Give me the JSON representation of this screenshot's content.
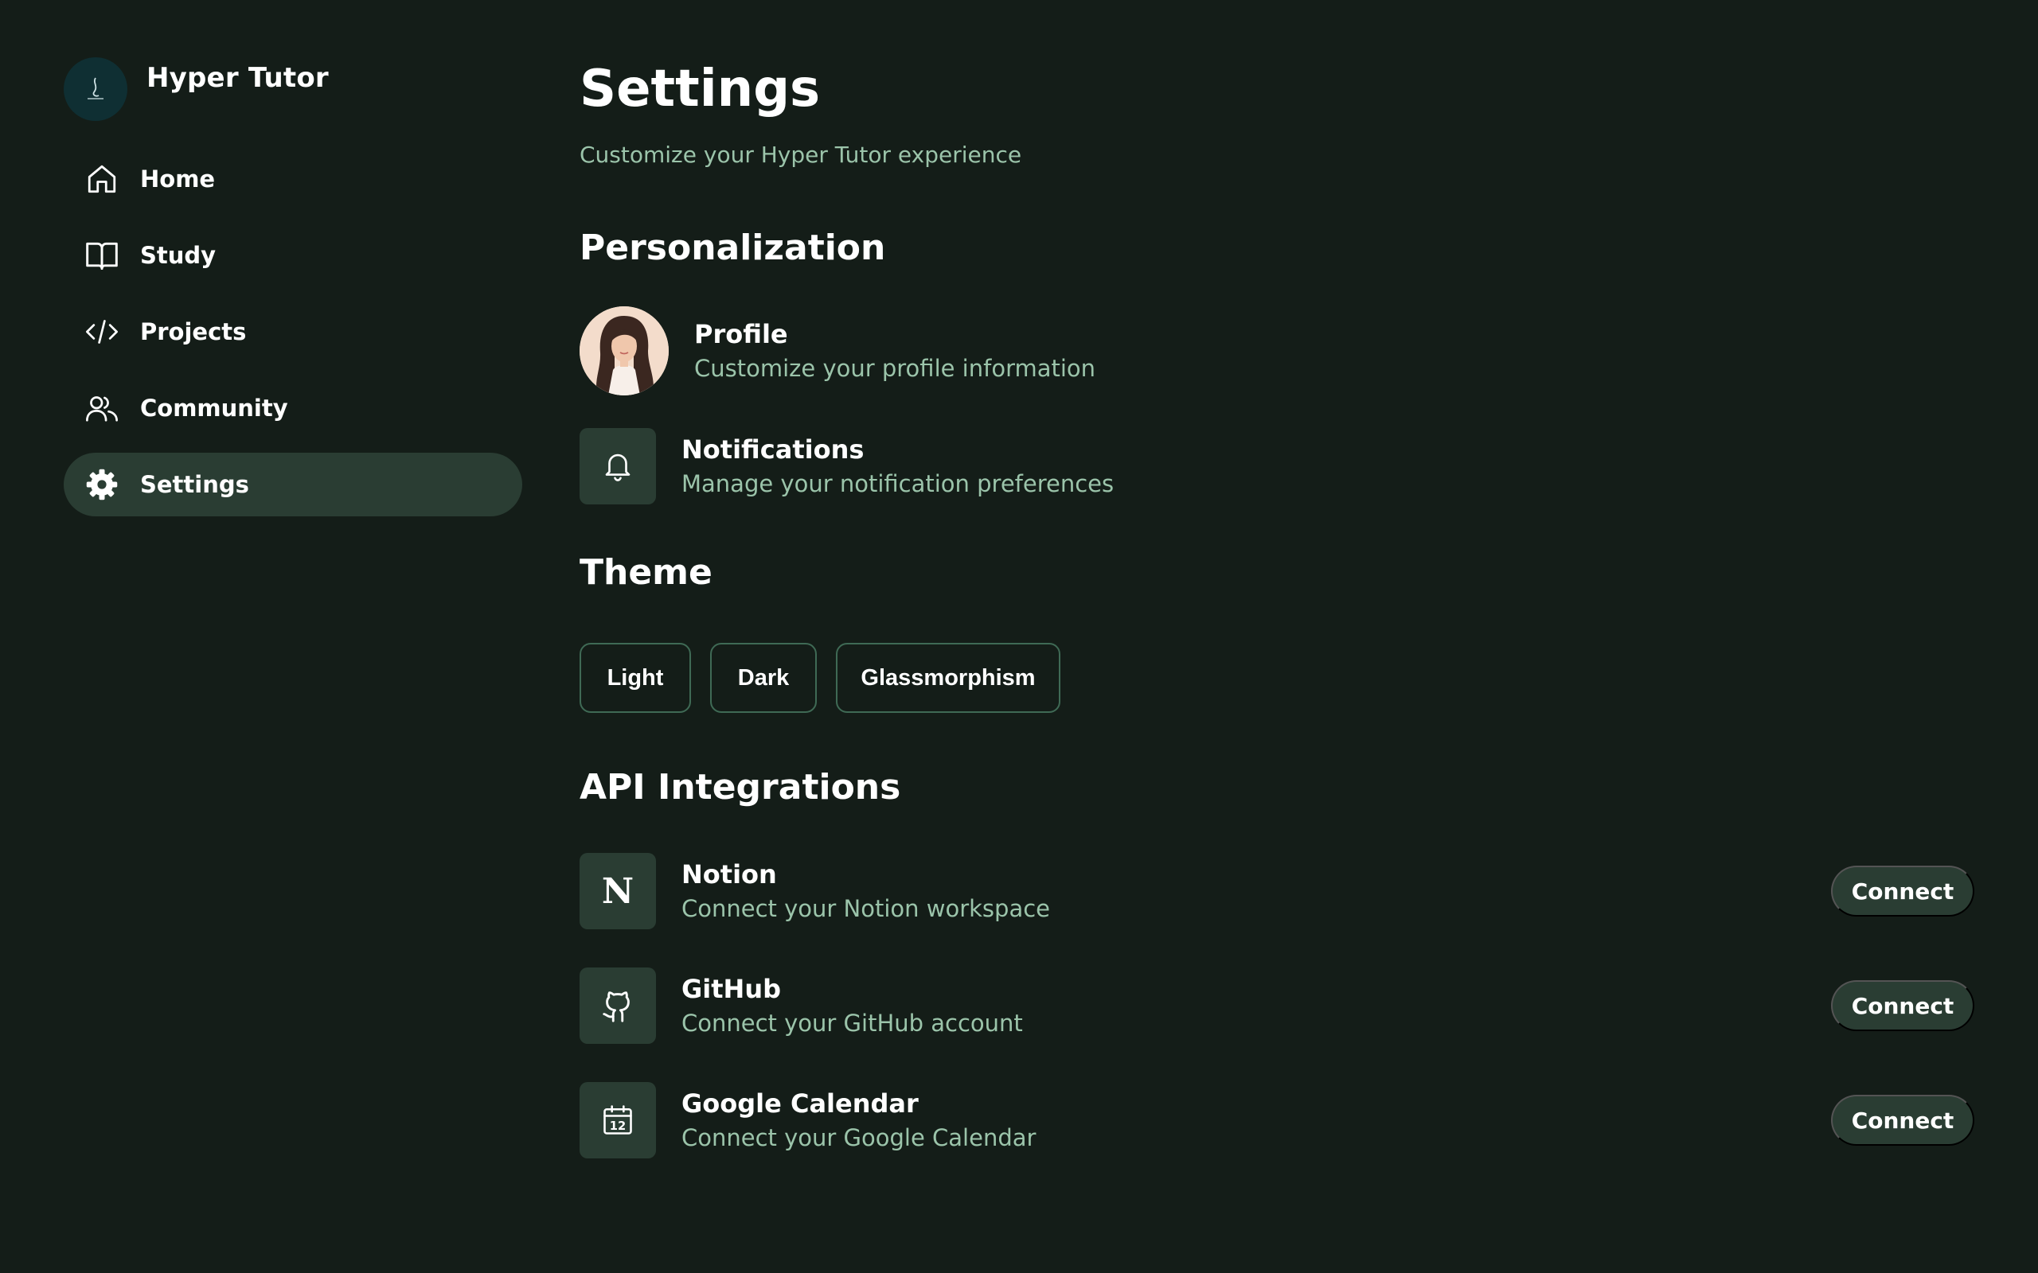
{
  "app": {
    "name": "Hyper Tutor"
  },
  "sidebar": {
    "items": [
      {
        "label": "Home",
        "icon": "home-icon"
      },
      {
        "label": "Study",
        "icon": "book-icon"
      },
      {
        "label": "Projects",
        "icon": "code-icon"
      },
      {
        "label": "Community",
        "icon": "users-icon"
      },
      {
        "label": "Settings",
        "icon": "gear-icon",
        "active": true
      }
    ]
  },
  "page": {
    "title": "Settings",
    "subtitle": "Customize your Hyper Tutor experience"
  },
  "personalization": {
    "title": "Personalization",
    "profile": {
      "title": "Profile",
      "desc": "Customize your profile information"
    },
    "notifications": {
      "title": "Notifications",
      "desc": "Manage your notification preferences",
      "icon": "bell-icon"
    }
  },
  "theme": {
    "title": "Theme",
    "options": [
      "Light",
      "Dark",
      "Glassmorphism"
    ]
  },
  "integrations": {
    "title": "API Integrations",
    "connect_label": "Connect",
    "items": [
      {
        "title": "Notion",
        "desc": "Connect your Notion workspace",
        "icon": "notion-icon"
      },
      {
        "title": "GitHub",
        "desc": "Connect your GitHub account",
        "icon": "github-icon"
      },
      {
        "title": "Google Calendar",
        "desc": "Connect your Google Calendar",
        "icon": "calendar-icon",
        "icon_text": "12"
      }
    ]
  },
  "colors": {
    "background": "#141d18",
    "surface": "#2a3d33",
    "muted_text": "#9bc4aa",
    "border": "#3f6a55"
  }
}
